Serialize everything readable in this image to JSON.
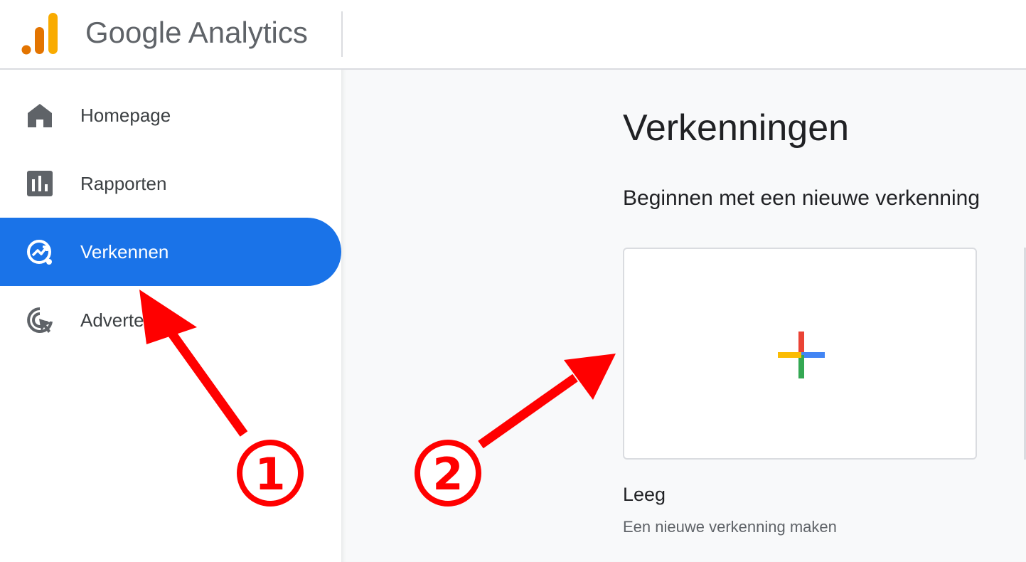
{
  "header": {
    "brand": "Google Analytics",
    "logo_icon": "google-analytics-logo-icon",
    "colors": {
      "bar_dark": "#e37400",
      "bar_light": "#f9ab00"
    }
  },
  "sidebar": {
    "items": [
      {
        "label": "Homepage",
        "icon": "home-icon",
        "active": false
      },
      {
        "label": "Rapporten",
        "icon": "reports-bar-chart-icon",
        "active": false
      },
      {
        "label": "Verkennen",
        "icon": "explore-icon",
        "active": true
      },
      {
        "label": "Advertenties",
        "icon": "advertising-cursor-icon",
        "active": false
      }
    ],
    "active_color": "#1a73e8"
  },
  "main": {
    "title": "Verkenningen",
    "section_title": "Beginnen met een nieuwe verkenning",
    "card": {
      "icon": "plus-icon",
      "title": "Leeg",
      "subtitle": "Een nieuwe verkenning maken",
      "plus_colors": {
        "top": "#ea4335",
        "right": "#4285f4",
        "bottom": "#34a853",
        "left": "#fbbc04"
      }
    }
  },
  "annotations": {
    "color": "#ff0000",
    "steps": [
      {
        "number": "1"
      },
      {
        "number": "2"
      }
    ]
  }
}
